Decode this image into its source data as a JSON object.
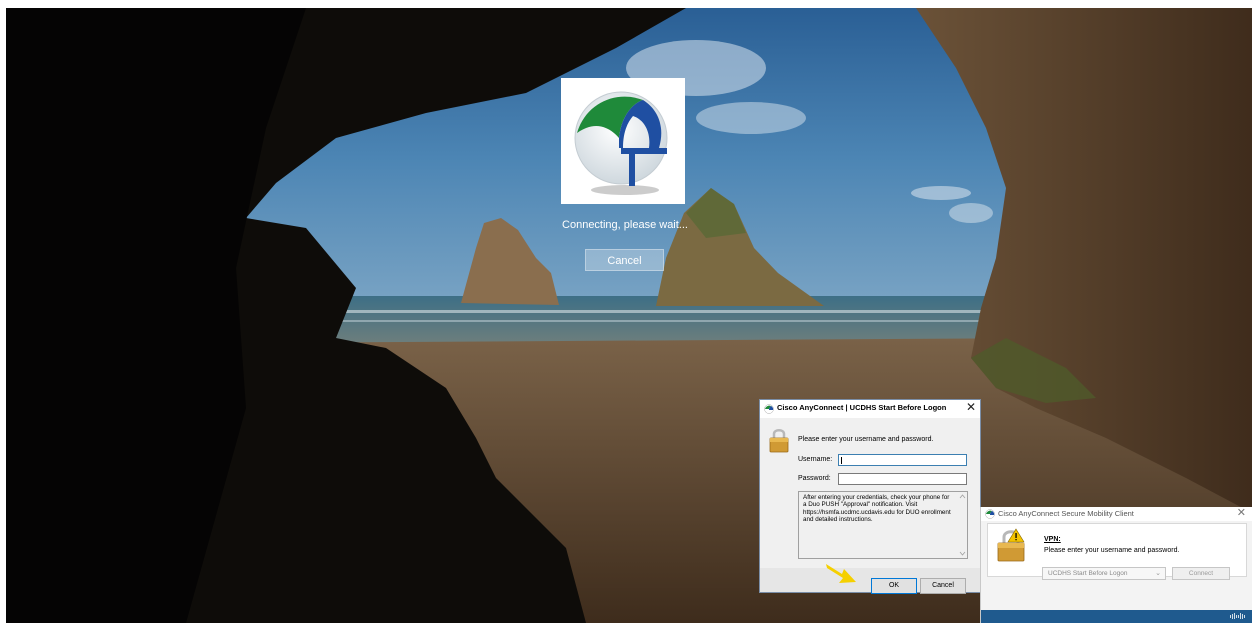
{
  "logon": {
    "status_text": "Connecting, please wait...",
    "cancel_label": "Cancel"
  },
  "dialog_credentials": {
    "title": "Cisco AnyConnect | UCDHS Start Before Logon",
    "close_glyph": "✕",
    "prompt": "Please enter your username and password.",
    "username_label": "Username:",
    "username_value": "",
    "password_label": "Password:",
    "password_value": "",
    "message": "After entering your credentials, check your phone for a Duo PUSH \"Approval\" notification. Visit https://hsmfa.ucdmc.ucdavis.edu for DUO enrollment and detailed instructions.",
    "ok_label": "OK",
    "cancel_label": "Cancel"
  },
  "dialog_client": {
    "title": "Cisco AnyConnect Secure Mobility Client",
    "close_glyph": "✕",
    "vpn_heading": "VPN:",
    "vpn_message": "Please enter your username and password.",
    "profile_selected": "UCDHS Start Before Logon",
    "connect_label": "Connect"
  },
  "icons": {
    "app_logo": "cisco-anyconnect-globe-icon",
    "lock": "padlock-icon",
    "warning": "warning-icon",
    "pointer": "yellow-arrow-icon"
  },
  "colors": {
    "ok_focus": "#0078d7",
    "footer_brand": "#1f5a8e",
    "arrow": "#f5d000"
  }
}
